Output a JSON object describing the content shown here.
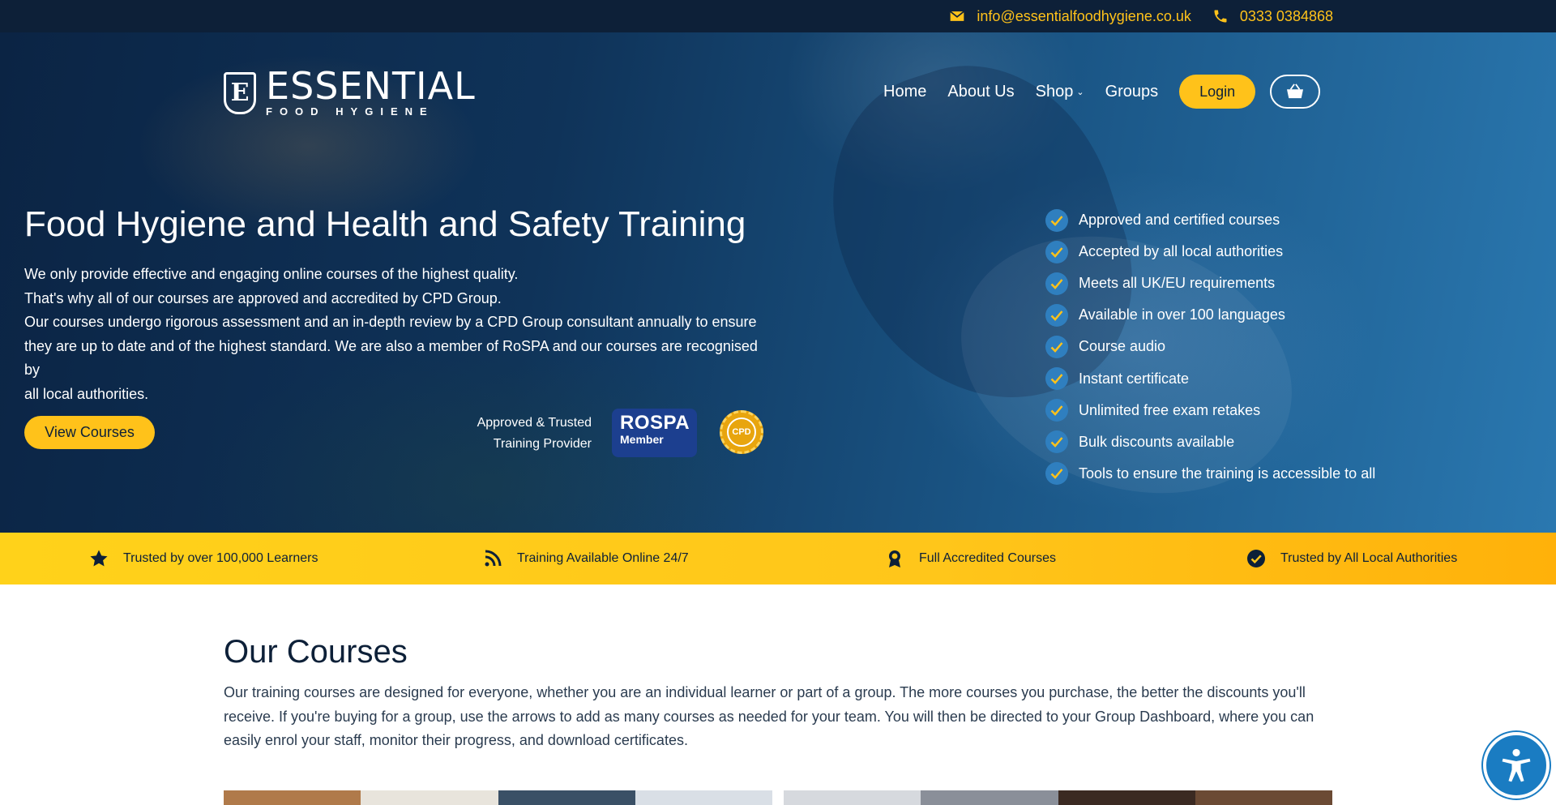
{
  "topbar": {
    "email": "info@essentialfoodhygiene.co.uk",
    "phone": "0333 0384868",
    "email_icon": "envelope-icon",
    "phone_icon": "phone-icon"
  },
  "logo": {
    "mark": "E",
    "title": "ESSENTIAL",
    "subtitle": "FOOD HYGIENE"
  },
  "nav": {
    "items": [
      {
        "label": "Home"
      },
      {
        "label": "About Us"
      },
      {
        "label": "Shop",
        "has_dropdown": true
      },
      {
        "label": "Groups"
      }
    ],
    "login_label": "Login",
    "cart_icon": "basket-icon"
  },
  "hero": {
    "title": "Food Hygiene and Health and Safety Training",
    "paragraph_lines": [
      "We only provide effective and engaging online courses of the highest quality.",
      "That's why all of our courses are approved and accredited by CPD Group.",
      "Our courses undergo rigorous assessment and an in-depth review by a CPD Group consultant annually to ensure",
      "they are up to date and of the highest standard. We are also a member of RoSPA and our courses are recognised by",
      "all local authorities."
    ],
    "cta_label": "View Courses",
    "approved_line1": "Approved & Trusted",
    "approved_line2": "Training Provider",
    "rospa_title": "ROSPA",
    "rospa_sub": "Member",
    "cpd_label": "CPD"
  },
  "features": [
    "Approved and certified courses",
    "Accepted by all local authorities",
    "Meets all UK/EU requirements",
    "Available in over 100 languages",
    "Course audio",
    "Instant certificate",
    "Unlimited free exam retakes",
    "Bulk discounts available",
    "Tools to ensure the training is accessible to all"
  ],
  "trustbar": [
    {
      "label": "Trusted by over 100,000 Learners",
      "icon": "star-icon"
    },
    {
      "label": "Training Available Online 24/7",
      "icon": "rss-icon"
    },
    {
      "label": "Full Accredited Courses",
      "icon": "award-icon"
    },
    {
      "label": "Trusted by All Local Authorities",
      "icon": "check-circle-icon"
    }
  ],
  "courses": {
    "title": "Our Courses",
    "text": "Our training courses are designed for everyone, whether you are an individual learner or part of a group. The more courses you purchase, the better the discounts you'll receive. If you're buying for a group, use the arrows to add as many courses as needed for your team. You will then be directed to your Group Dashboard, where you can easily enrol your staff, monitor their progress, and download certificates."
  },
  "accessibility_icon": "accessibility-icon",
  "colors": {
    "accent": "#ffc21a",
    "navy": "#0d2038",
    "check_blue": "#2f7fbf"
  }
}
